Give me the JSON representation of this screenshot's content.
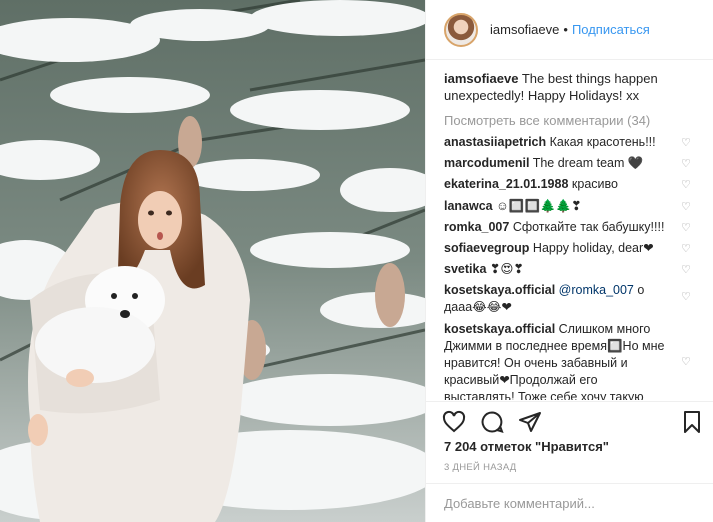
{
  "header": {
    "username": "iamsofiaeve",
    "separator": "•",
    "follow_label": "Подписаться"
  },
  "caption": {
    "username": "iamsofiaeve",
    "text": "The best things happen unexpectedly! Happy Holidays! xx"
  },
  "view_all_comments": "Посмотреть все комментарии (34)",
  "comments": [
    {
      "user": "anastasiiapetrich",
      "text": "Какая красотень!!!"
    },
    {
      "user": "marcodumenil",
      "text": "The dream team 🖤"
    },
    {
      "user": "ekaterina_21.01.1988",
      "text": "красиво"
    },
    {
      "user": "lanawca",
      "text": "☺🔲🔲🌲🌲❣"
    },
    {
      "user": "romka_007",
      "text": "Сфоткайте так бабушку!!!!"
    },
    {
      "user": "sofiaevegroup",
      "text": "Happy holiday, dear❤"
    },
    {
      "user": "svetika",
      "text": "❣😍❣"
    },
    {
      "user": "kosetskaya.official",
      "mention": "@romka_007",
      "text": "о дааа😂😂❤"
    },
    {
      "user": "kosetskaya.official",
      "text": "Слишком много Джимми в последнее время🔲Но мне нравится! Он очень забавный и красивый❤Продолжай его выставлять! Тоже себе хочу такую"
    }
  ],
  "likes": "7 204 отметок \"Нравится\"",
  "date": "3 ДНЕЙ НАЗАД",
  "comment_input": {
    "placeholder": "Добавьте комментарий..."
  },
  "icons": {
    "like": "heart-outline-icon",
    "comment": "speech-bubble-icon",
    "share": "paper-plane-icon",
    "save": "bookmark-icon",
    "comment_like": "small-heart-icon"
  },
  "colors": {
    "accent": "#3897f0",
    "text": "#262626",
    "muted": "#999999",
    "border": "#efefef"
  }
}
